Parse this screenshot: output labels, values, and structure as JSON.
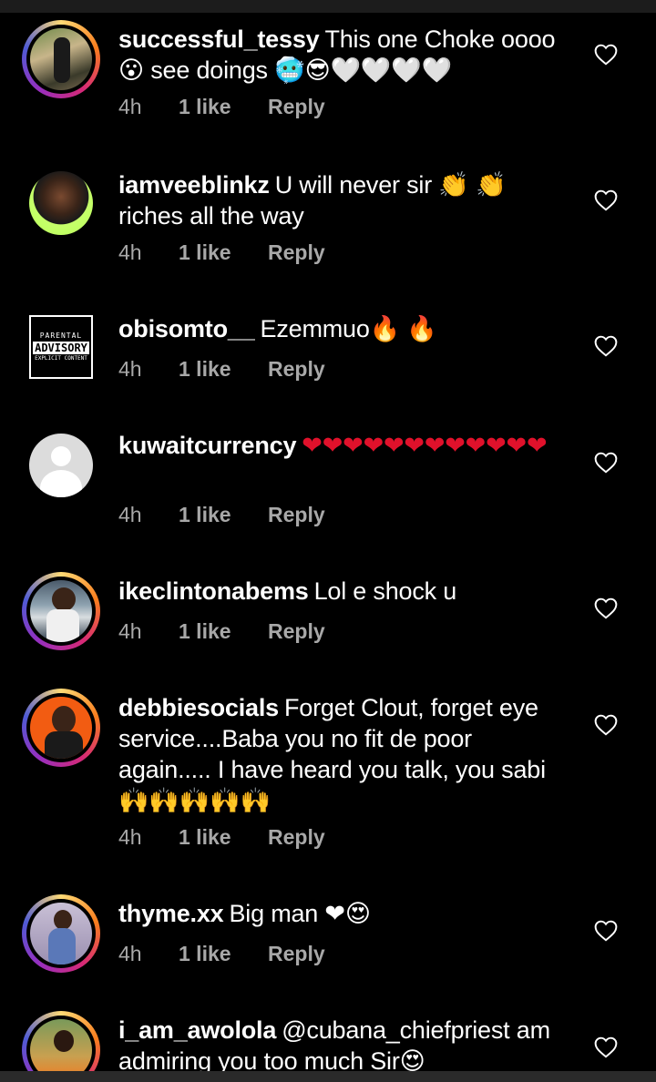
{
  "comments": [
    {
      "username": "successful_tessy",
      "text": "This one Choke oooo 😮 see doings 🥶😎🤍🤍🤍🤍",
      "time": "4h",
      "likes": "1 like",
      "reply": "Reply",
      "avatar": "avatar-photo"
    },
    {
      "username": "iamveeblinkz",
      "text": "U will never sir 👏 👏 riches all the way",
      "time": "4h",
      "likes": "1 like",
      "reply": "Reply",
      "avatar": "avatar-photo"
    },
    {
      "username": "obisomto__",
      "text": "Ezemmuo🔥 🔥",
      "time": "4h",
      "likes": "1 like",
      "reply": "Reply",
      "avatar": "parental-advisory-logo",
      "avatar_label": [
        "PARENTAL",
        "ADVISORY",
        "EXPLICIT CONTENT"
      ]
    },
    {
      "username": "kuwaitcurrency",
      "text": "❤❤❤❤❤❤❤❤❤❤❤❤",
      "time": "4h",
      "likes": "1 like",
      "reply": "Reply",
      "avatar": "default-avatar"
    },
    {
      "username": "ikeclintonabems",
      "text": "Lol e shock u",
      "time": "4h",
      "likes": "1 like",
      "reply": "Reply",
      "avatar": "avatar-photo"
    },
    {
      "username": "debbiesocials",
      "text": "Forget Clout, forget eye service....Baba you no fit de poor again..... I have heard you talk, you sabi 🙌🙌🙌🙌🙌",
      "time": "4h",
      "likes": "1 like",
      "reply": "Reply",
      "avatar": "avatar-photo"
    },
    {
      "username": "thyme.xx",
      "text": "Big man ❤😍",
      "time": "4h",
      "likes": "1 like",
      "reply": "Reply",
      "avatar": "avatar-photo"
    },
    {
      "username": "i_am_awolola",
      "text": "@cubana_chiefpriest am admiring you too much Sir😍",
      "avatar": "avatar-photo"
    }
  ],
  "colors": {
    "background": "#000000",
    "meta": "#a8a8a8",
    "heart_icon": "#ffffff",
    "red_heart": "#e0112b"
  }
}
